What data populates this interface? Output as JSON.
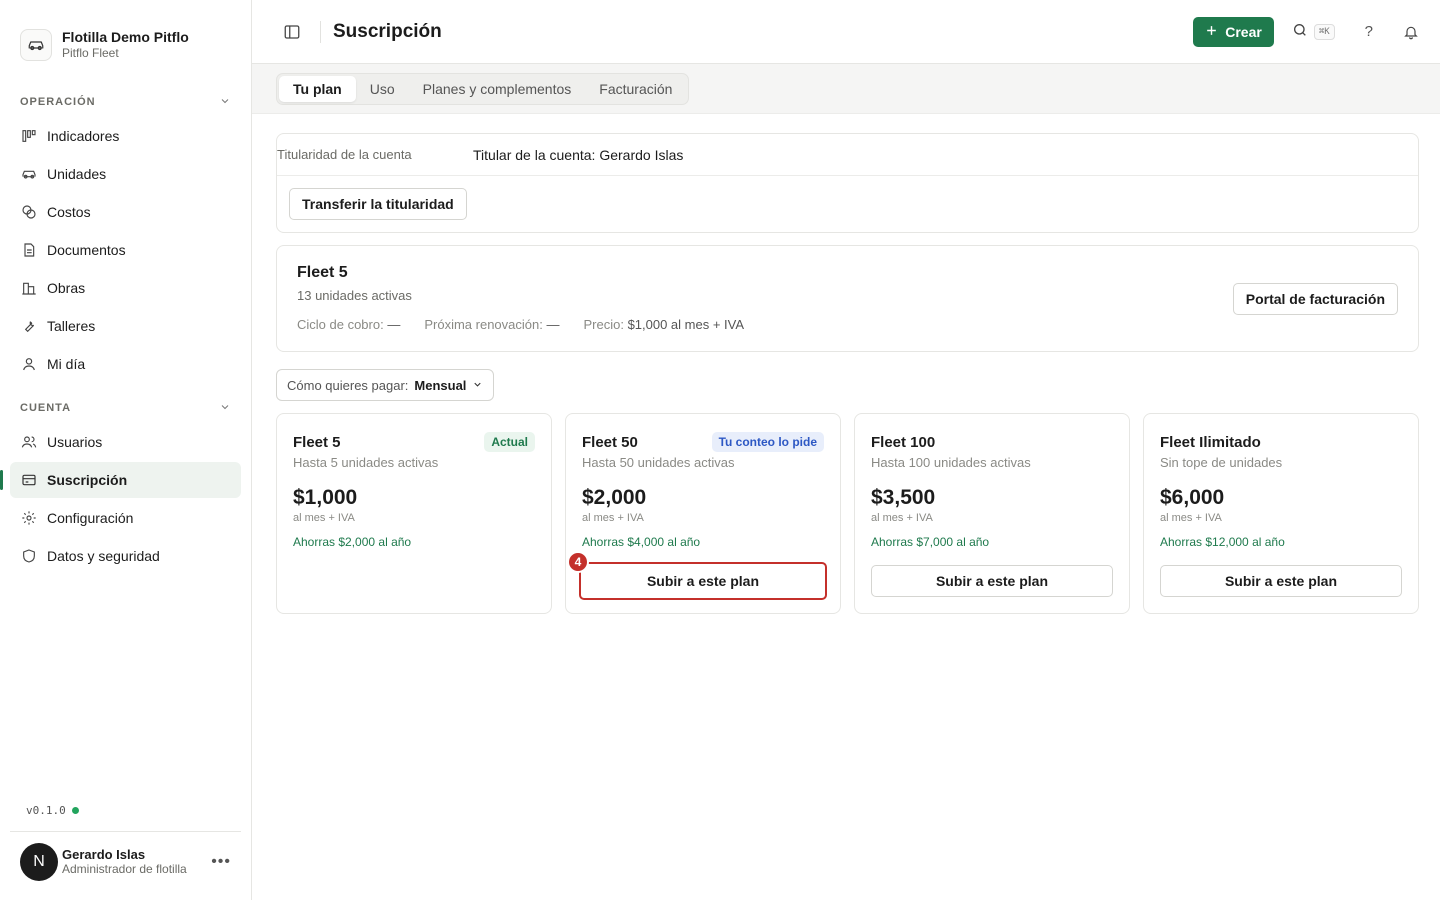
{
  "org": {
    "name": "Flotilla Demo Pitflo",
    "subtitle": "Pitflo Fleet"
  },
  "sidebar": {
    "sections": [
      {
        "title": "OPERACIÓN",
        "items": [
          {
            "label": "Indicadores",
            "icon": "chart-icon"
          },
          {
            "label": "Unidades",
            "icon": "car-icon"
          },
          {
            "label": "Costos",
            "icon": "coins-icon"
          },
          {
            "label": "Documentos",
            "icon": "document-icon"
          },
          {
            "label": "Obras",
            "icon": "building-icon"
          },
          {
            "label": "Talleres",
            "icon": "wrench-icon"
          },
          {
            "label": "Mi día",
            "icon": "user-icon"
          }
        ]
      },
      {
        "title": "CUENTA",
        "items": [
          {
            "label": "Usuarios",
            "icon": "users-icon"
          },
          {
            "label": "Suscripción",
            "icon": "credit-card-icon",
            "active": true
          },
          {
            "label": "Configuración",
            "icon": "gear-icon"
          },
          {
            "label": "Datos y seguridad",
            "icon": "shield-icon"
          }
        ]
      }
    ],
    "version": "v0.1.0",
    "user": {
      "initial": "N",
      "name": "Gerardo Islas",
      "role": "Administrador de flotilla"
    }
  },
  "header": {
    "title": "Suscripción",
    "create_label": "Crear",
    "search_shortcut": "⌘K",
    "help_label": "?"
  },
  "tabs": [
    {
      "label": "Tu plan",
      "active": true
    },
    {
      "label": "Uso"
    },
    {
      "label": "Planes y complementos"
    },
    {
      "label": "Facturación"
    }
  ],
  "ownership": {
    "label": "Titularidad de la cuenta",
    "value": "Titular de la cuenta: Gerardo Islas",
    "transfer_label": "Transferir la titularidad"
  },
  "current_plan": {
    "name": "Fleet 5",
    "units": "13 unidades activas",
    "cycle_label": "Ciclo de cobro:",
    "cycle_value": "—",
    "renewal_label": "Próxima renovación:",
    "renewal_value": "—",
    "price_label": "Precio:",
    "price_value": "$1,000 al mes + IVA",
    "portal_label": "Portal de facturación"
  },
  "payment": {
    "label": "Cómo quieres pagar:",
    "value": "Mensual"
  },
  "plans": [
    {
      "name": "Fleet 5",
      "badge": "Actual",
      "subtitle": "Hasta 5 unidades activas",
      "price": "$1,000",
      "per": "al mes + IVA",
      "savings": "Ahorras $2,000 al año"
    },
    {
      "name": "Fleet 50",
      "badge": "Tu conteo lo pide",
      "subtitle": "Hasta 50 unidades activas",
      "price": "$2,000",
      "per": "al mes + IVA",
      "savings": "Ahorras $4,000 al año",
      "button": "Subir a este plan",
      "step": "4"
    },
    {
      "name": "Fleet 100",
      "subtitle": "Hasta 100 unidades activas",
      "price": "$3,500",
      "per": "al mes + IVA",
      "savings": "Ahorras $7,000 al año",
      "button": "Subir a este plan"
    },
    {
      "name": "Fleet Ilimitado",
      "subtitle": "Sin tope de unidades",
      "price": "$6,000",
      "per": "al mes + IVA",
      "savings": "Ahorras $12,000 al año",
      "button": "Subir a este plan"
    }
  ],
  "colors": {
    "brand": "#1f7a4d",
    "focus": "#c4302b",
    "badge_blue": "#2d58c4"
  }
}
